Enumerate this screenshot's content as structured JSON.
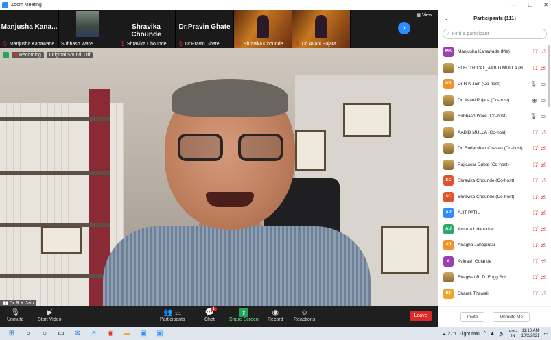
{
  "window": {
    "title": "Zoom Meeting"
  },
  "gallery": {
    "tiles": [
      {
        "big_name": "Manjusha  Kana...",
        "label": "Manjusha Kanawade",
        "type": "name"
      },
      {
        "big_name": "",
        "label": "Subhash Ware",
        "type": "photo"
      },
      {
        "big_name": "Shravika Chounde",
        "label": "Shravika Chounde",
        "type": "name"
      },
      {
        "big_name": "Dr.Pravin Ghate",
        "label": "Dr.Pravin Ghate",
        "type": "name"
      },
      {
        "big_name": "",
        "label": "Shravika Chounde",
        "type": "webinar"
      },
      {
        "big_name": "",
        "label": "Dr. Avani Pujara",
        "type": "webinar"
      }
    ],
    "view_label": "View"
  },
  "overlay": {
    "recording_label": "Recording",
    "sound_label": "Original Sound: Off"
  },
  "speaker": {
    "name": "Dr R K Jain"
  },
  "controls": {
    "unmute": "Unmute",
    "start_video": "Start Video",
    "participants": "Participants",
    "participants_count": "111",
    "chat": "Chat",
    "chat_badge": "1",
    "share_screen": "Share Screen",
    "record": "Record",
    "reactions": "Reactions",
    "leave": "Leave"
  },
  "panel": {
    "title": "Participants (111)",
    "search_placeholder": "Find a participant",
    "participants": [
      {
        "initials": "MK",
        "color": "#9c3fb5",
        "name": "Manjusha Kanawade (Me)",
        "mic": "off",
        "video": "off"
      },
      {
        "initials": "",
        "color": "",
        "name": "ELECTRICAL_AABID MULLA (Host)",
        "mic": "off",
        "video": "off"
      },
      {
        "initials": "DR",
        "color": "#f0932b",
        "name": "Dr R K Jain (Co-host)",
        "mic": "on",
        "video": "on"
      },
      {
        "initials": "",
        "color": "",
        "name": "Dr. Avani Pujara (Co-host)",
        "mic": "rec",
        "video": "on"
      },
      {
        "initials": "",
        "color": "",
        "name": "Subhash Ware (Co-host)",
        "mic": "on",
        "video": "on"
      },
      {
        "initials": "",
        "color": "",
        "name": "AABID MULLA (Co-host)",
        "mic": "off",
        "video": "off"
      },
      {
        "initials": "",
        "color": "",
        "name": "Dr. Sudarshan Chavan (Co-host)",
        "mic": "off",
        "video": "off"
      },
      {
        "initials": "",
        "color": "",
        "name": "Rajkuwar Dubal (Co-host)",
        "mic": "off",
        "video": "off"
      },
      {
        "initials": "SC",
        "color": "#e0532b",
        "name": "Shravika Chounde (Co-host)",
        "mic": "off",
        "video": "off"
      },
      {
        "initials": "SC",
        "color": "#e0532b",
        "name": "Shravika Chounde (Co-host)",
        "mic": "off",
        "video": "off"
      },
      {
        "initials": "AP",
        "color": "#2d8cff",
        "name": "AJIT PATIL",
        "mic": "off",
        "video": "off"
      },
      {
        "initials": "AU",
        "color": "#2aa96b",
        "name": "Amruta Udapurkar",
        "mic": "off",
        "video": "off"
      },
      {
        "initials": "AJ",
        "color": "#f0932b",
        "name": "Anagha Jahagirdar",
        "mic": "off",
        "video": "off"
      },
      {
        "initials": "a",
        "color": "#9c3fb5",
        "name": "Avinash Golande",
        "mic": "off",
        "video": "off"
      },
      {
        "initials": "",
        "color": "",
        "name": "Bhagwat  R. D. Engg Sci",
        "mic": "off",
        "video": "off"
      },
      {
        "initials": "BT",
        "color": "#f0a42b",
        "name": "Bharati Thawali",
        "mic": "off",
        "video": "off"
      }
    ],
    "invite": "Invite",
    "unmute_me": "Unmute Me"
  },
  "taskbar": {
    "weather": "27°C  Light rain",
    "lang_top": "ENG",
    "lang_bottom": "IN",
    "time": "11:10 AM",
    "date": "10/2/2021"
  }
}
